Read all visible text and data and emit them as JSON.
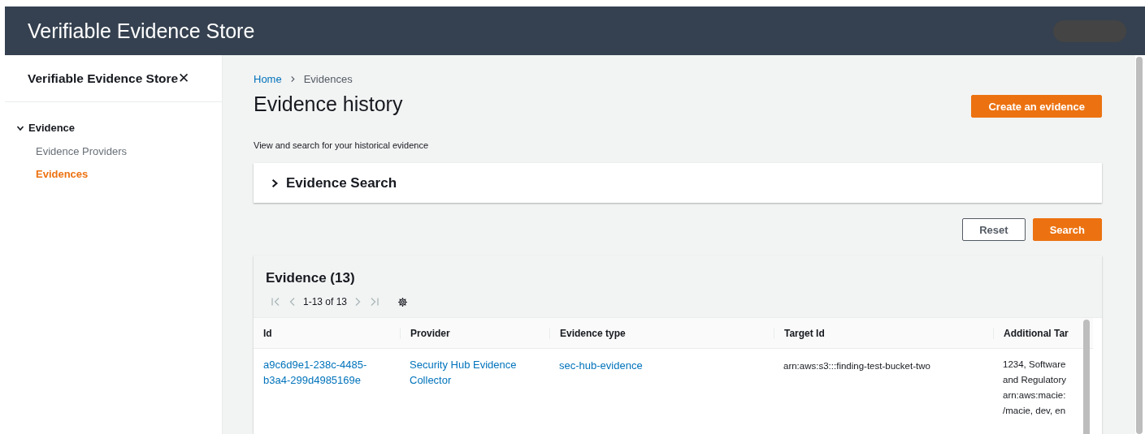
{
  "header": {
    "title": "Verifiable Evidence Store"
  },
  "sidebar": {
    "title": "Verifiable Evidence Store",
    "close": "✕",
    "sections": [
      {
        "label": "Evidence",
        "expanded": true,
        "items": [
          {
            "label": "Evidence Providers",
            "selected": false
          },
          {
            "label": "Evidences",
            "selected": true
          }
        ]
      }
    ]
  },
  "breadcrumbs": [
    {
      "label": "Home",
      "link": true
    },
    {
      "label": "Evidences",
      "link": false
    }
  ],
  "page": {
    "title": "Evidence history",
    "description": "View and search for your historical evidence",
    "create_button": "Create an evidence"
  },
  "search_panel": {
    "title": "Evidence Search",
    "expanded": false
  },
  "buttons": [
    {
      "label": "Reset",
      "kind": "secondary"
    },
    {
      "label": "Search",
      "kind": "primary"
    }
  ],
  "table": {
    "title": "Evidence (13)",
    "pagination": "1-13 of 13",
    "columns": [
      "Id",
      "Provider",
      "Evidence type",
      "Target Id",
      "Additional Tar"
    ],
    "rows": [
      {
        "cells": [
          {
            "kind": "link",
            "lines": [
              "a9c6d9e1-238c-4485-",
              "b3a4-299d4985169e"
            ]
          },
          {
            "kind": "link",
            "lines": [
              "Security Hub Evidence",
              "Collector"
            ]
          },
          {
            "kind": "link",
            "lines": [
              "sec-hub-evidence"
            ]
          },
          {
            "kind": "text",
            "lines": [
              "arn:aws:s3:::finding-test-bucket-two"
            ]
          },
          {
            "kind": "text",
            "lines": [
              "1234, Software",
              "and Regulatory",
              "arn:aws:macie:",
              "/macie, dev, en"
            ]
          }
        ]
      }
    ]
  }
}
